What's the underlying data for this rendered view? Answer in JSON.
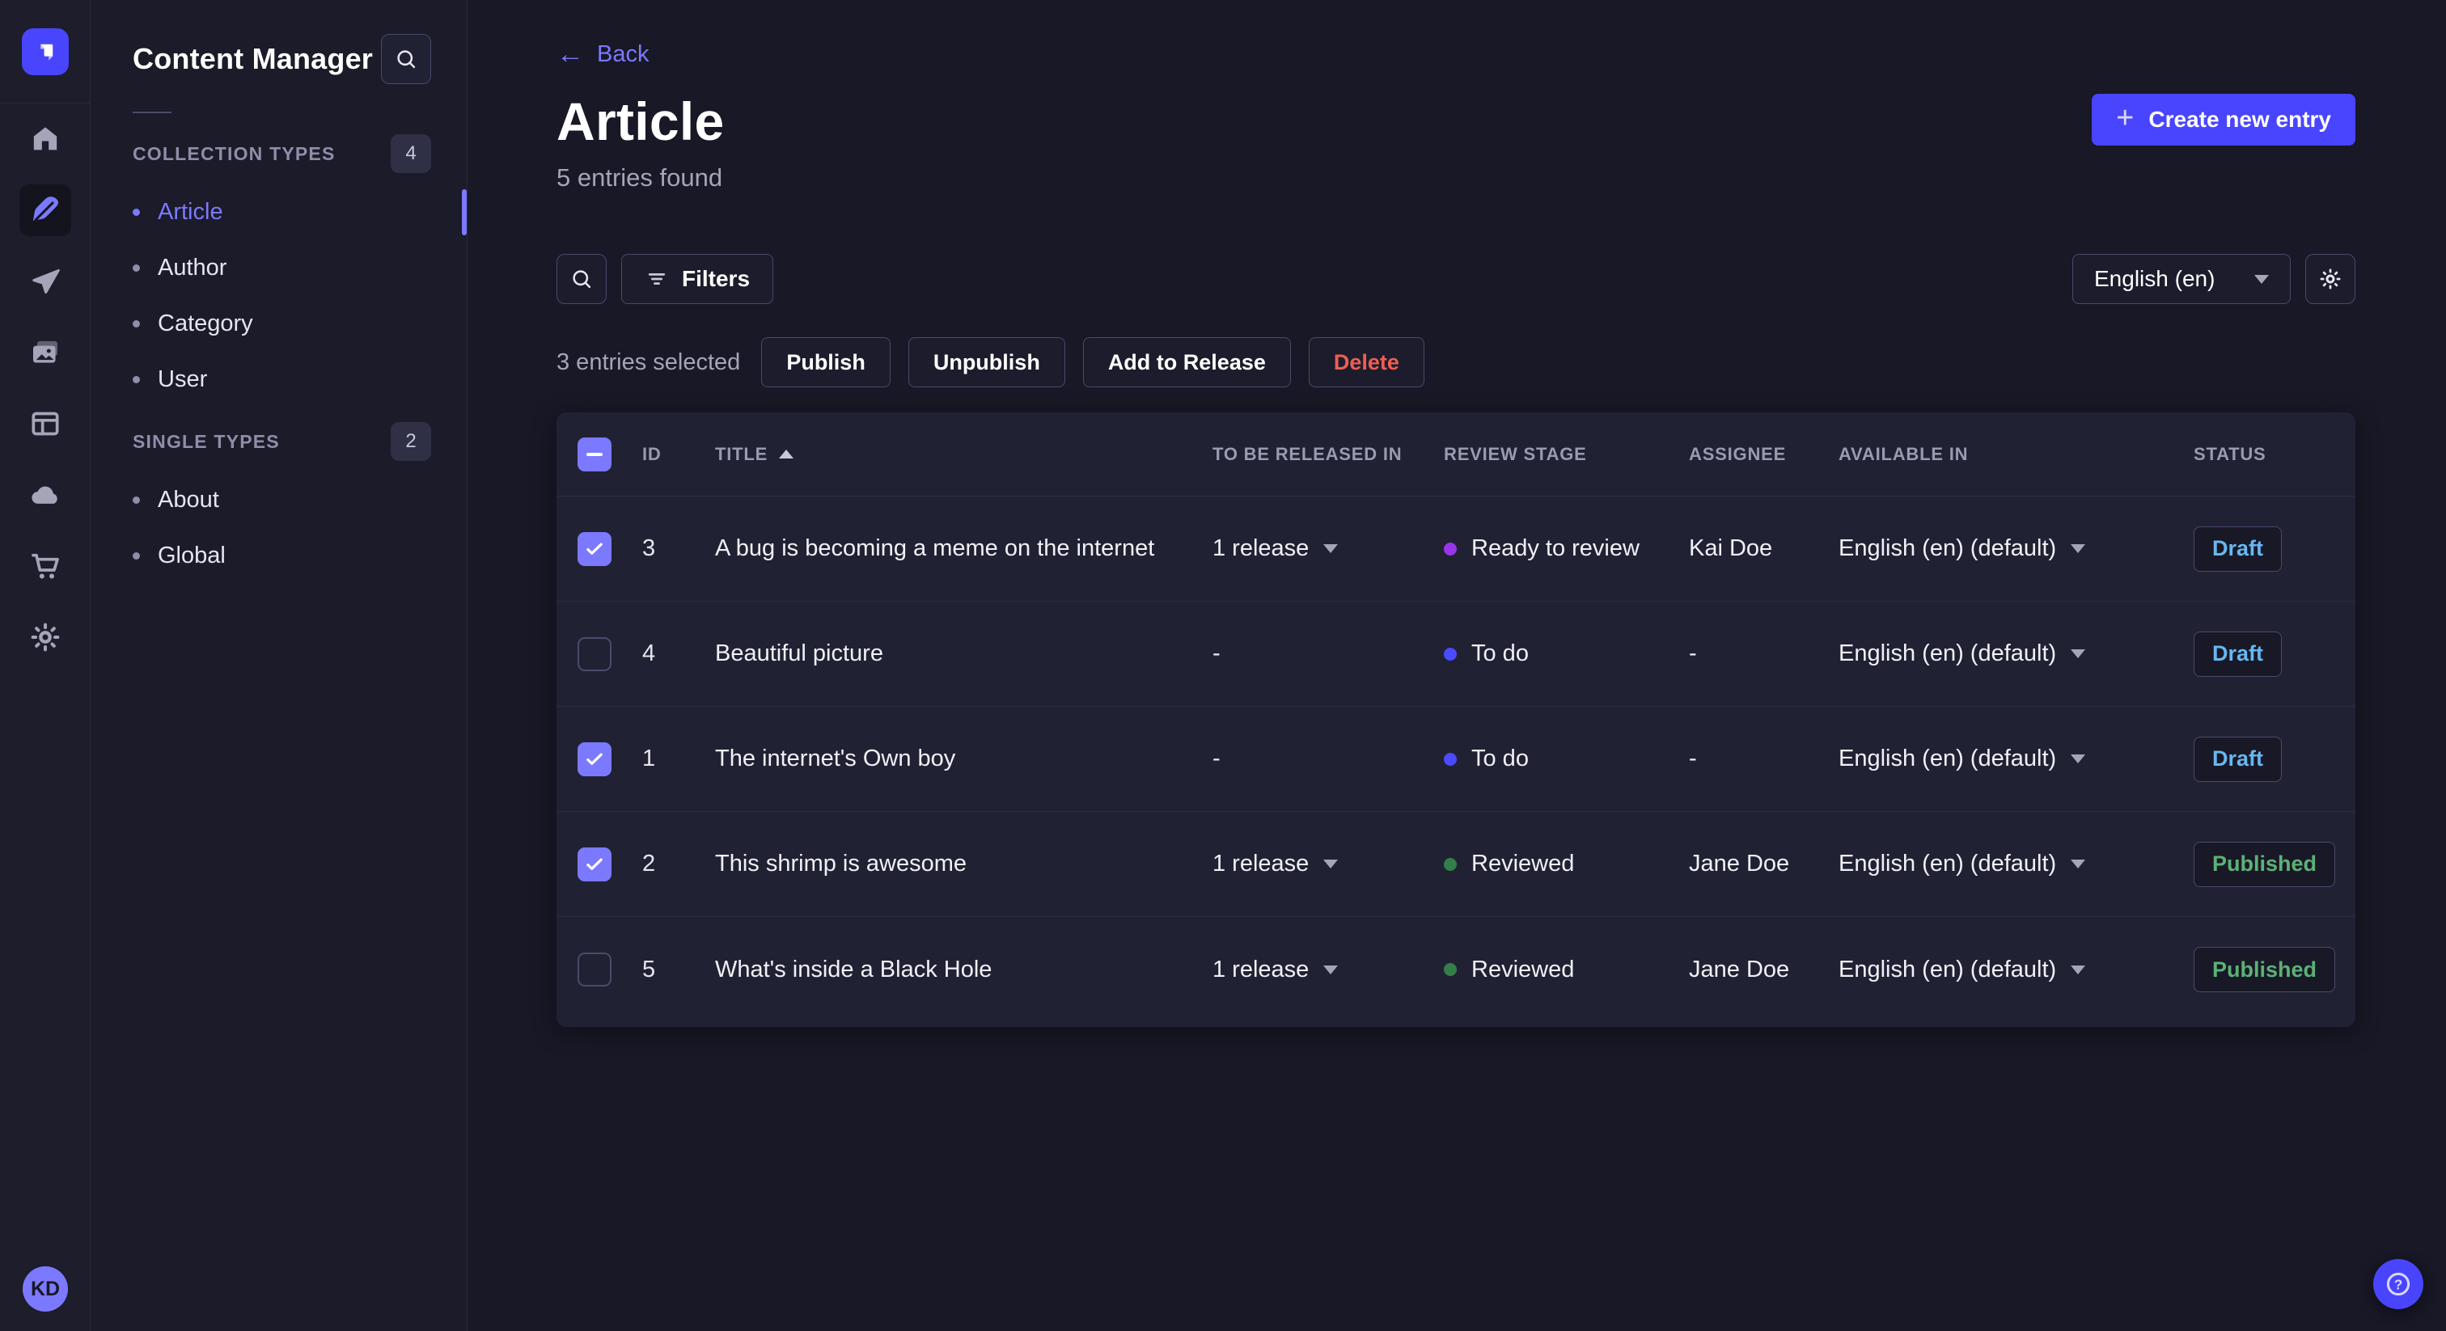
{
  "colors": {
    "accent": "#4945ff",
    "accent_light": "#7b79ff",
    "draft_blue": "#66b7f1",
    "published_green": "#5cb176",
    "danger_red": "#ee5e52",
    "dot_ready": "#9736e8",
    "dot_todo": "#4a4aff",
    "dot_reviewed": "#328048"
  },
  "nav_rail": {
    "items": [
      "home",
      "content-manager",
      "releases",
      "media-library",
      "content-type-builder",
      "deploy",
      "marketplace",
      "settings"
    ],
    "active": "content-manager",
    "avatar_initials": "KD"
  },
  "subnav": {
    "title": "Content Manager",
    "sections": [
      {
        "label": "COLLECTION TYPES",
        "badge": "4",
        "items": [
          {
            "label": "Article",
            "active": true
          },
          {
            "label": "Author"
          },
          {
            "label": "Category"
          },
          {
            "label": "User"
          }
        ]
      },
      {
        "label": "SINGLE TYPES",
        "badge": "2",
        "items": [
          {
            "label": "About"
          },
          {
            "label": "Global"
          }
        ]
      }
    ]
  },
  "header": {
    "back_label": "Back",
    "title": "Article",
    "subtitle": "5 entries found",
    "create_button": "Create new entry"
  },
  "toolbar": {
    "filters_label": "Filters",
    "locale": "English (en)"
  },
  "selection": {
    "text": "3 entries selected",
    "actions": [
      "Publish",
      "Unpublish",
      "Add to Release",
      "Delete"
    ]
  },
  "table": {
    "header_indeterminate": true,
    "headers": [
      "ID",
      "TITLE",
      "TO BE RELEASED IN",
      "REVIEW STAGE",
      "ASSIGNEE",
      "AVAILABLE IN",
      "STATUS"
    ],
    "rows": [
      {
        "checked": true,
        "id": "3",
        "title": "A bug is becoming a meme on the internet",
        "release": "1 release",
        "has_release": true,
        "review_stage": "Ready to review",
        "review_color": "#9736e8",
        "assignee": "Kai Doe",
        "available": "English (en) (default)",
        "status": "Draft",
        "status_color": "#66b7f1"
      },
      {
        "checked": false,
        "id": "4",
        "title": "Beautiful picture",
        "release": "-",
        "has_release": false,
        "review_stage": "To do",
        "review_color": "#4a4aff",
        "assignee": "-",
        "available": "English (en) (default)",
        "status": "Draft",
        "status_color": "#66b7f1"
      },
      {
        "checked": true,
        "id": "1",
        "title": "The internet's Own boy",
        "release": "-",
        "has_release": false,
        "review_stage": "To do",
        "review_color": "#4a4aff",
        "assignee": "-",
        "available": "English (en) (default)",
        "status": "Draft",
        "status_color": "#66b7f1"
      },
      {
        "checked": true,
        "id": "2",
        "title": "This shrimp is awesome",
        "release": "1 release",
        "has_release": true,
        "review_stage": "Reviewed",
        "review_color": "#328048",
        "assignee": "Jane Doe",
        "available": "English (en) (default)",
        "status": "Published",
        "status_color": "#5cb176"
      },
      {
        "checked": false,
        "id": "5",
        "title": "What's inside a Black Hole",
        "release": "1 release",
        "has_release": true,
        "review_stage": "Reviewed",
        "review_color": "#328048",
        "assignee": "Jane Doe",
        "available": "English (en) (default)",
        "status": "Published",
        "status_color": "#5cb176"
      }
    ]
  },
  "help": {
    "tooltip": "?"
  }
}
